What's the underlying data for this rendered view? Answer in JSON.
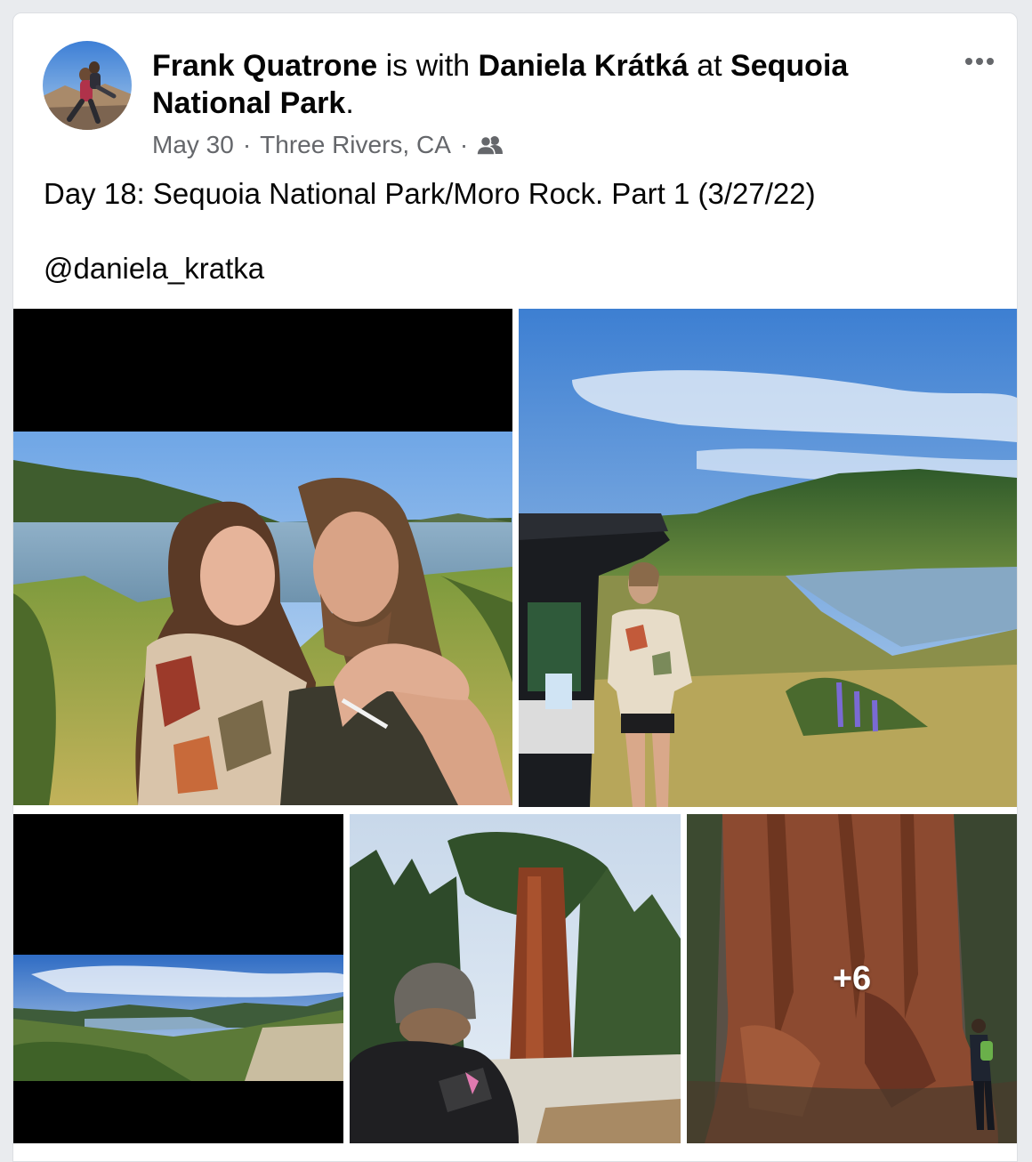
{
  "post": {
    "author": "Frank Quatrone",
    "is_with": "is with",
    "tagged": "Daniela Krátká",
    "at": "at",
    "place_line1": "Sequoia",
    "place_line2": "National Park",
    "period": ".",
    "date": "May 30",
    "separator": "·",
    "location": "Three Rivers, CA",
    "audience_icon": "friends-icon",
    "more_icon": "more-options-icon",
    "caption": "Day 18: Sequoia National Park/Moro Rock. Part 1 (3/27/22)",
    "mention": "@daniela_kratka"
  },
  "photos": {
    "more_count": "+6"
  },
  "colors": {
    "text_primary": "#050505",
    "text_secondary": "#65676b",
    "background": "#e9ebee"
  }
}
